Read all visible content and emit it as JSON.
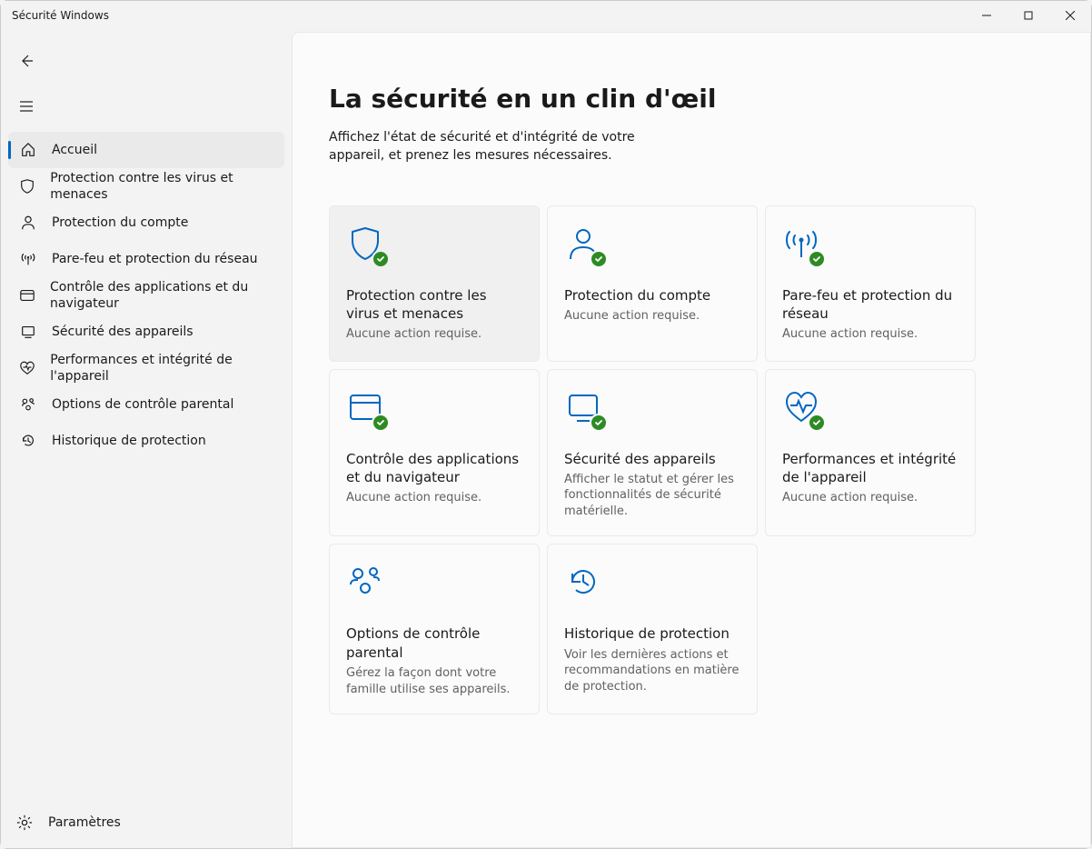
{
  "window": {
    "title": "Sécurité Windows"
  },
  "sidebar": {
    "items": [
      {
        "label": "Accueil"
      },
      {
        "label": "Protection contre les virus et menaces"
      },
      {
        "label": "Protection du compte"
      },
      {
        "label": "Pare-feu et protection du réseau"
      },
      {
        "label": "Contrôle des applications et du navigateur"
      },
      {
        "label": "Sécurité des appareils"
      },
      {
        "label": "Performances et intégrité de l'appareil"
      },
      {
        "label": "Options de contrôle parental"
      },
      {
        "label": "Historique de protection"
      }
    ],
    "settings_label": "Paramètres"
  },
  "main": {
    "title": "La sécurité en un clin d'œil",
    "subtitle": "Affichez l'état de sécurité et d'intégrité de votre appareil, et prenez les mesures nécessaires.",
    "tiles": [
      {
        "title": "Protection contre les virus et menaces",
        "status": "Aucune action requise."
      },
      {
        "title": "Protection du compte",
        "status": "Aucune action requise."
      },
      {
        "title": "Pare-feu et protection du réseau",
        "status": "Aucune action requise."
      },
      {
        "title": "Contrôle des applications et du navigateur",
        "status": "Aucune action requise."
      },
      {
        "title": "Sécurité des appareils",
        "status": "Afficher le statut et gérer les fonctionnalités de sécurité matérielle."
      },
      {
        "title": "Performances et intégrité de l'appareil",
        "status": "Aucune action requise."
      },
      {
        "title": "Options de contrôle parental",
        "status": "Gérez la façon dont votre famille utilise ses appareils."
      },
      {
        "title": "Historique de protection",
        "status": "Voir les dernières actions et recommandations en matière de protection."
      }
    ]
  },
  "colors": {
    "accent": "#0067c0",
    "ok": "#2e8b24"
  }
}
